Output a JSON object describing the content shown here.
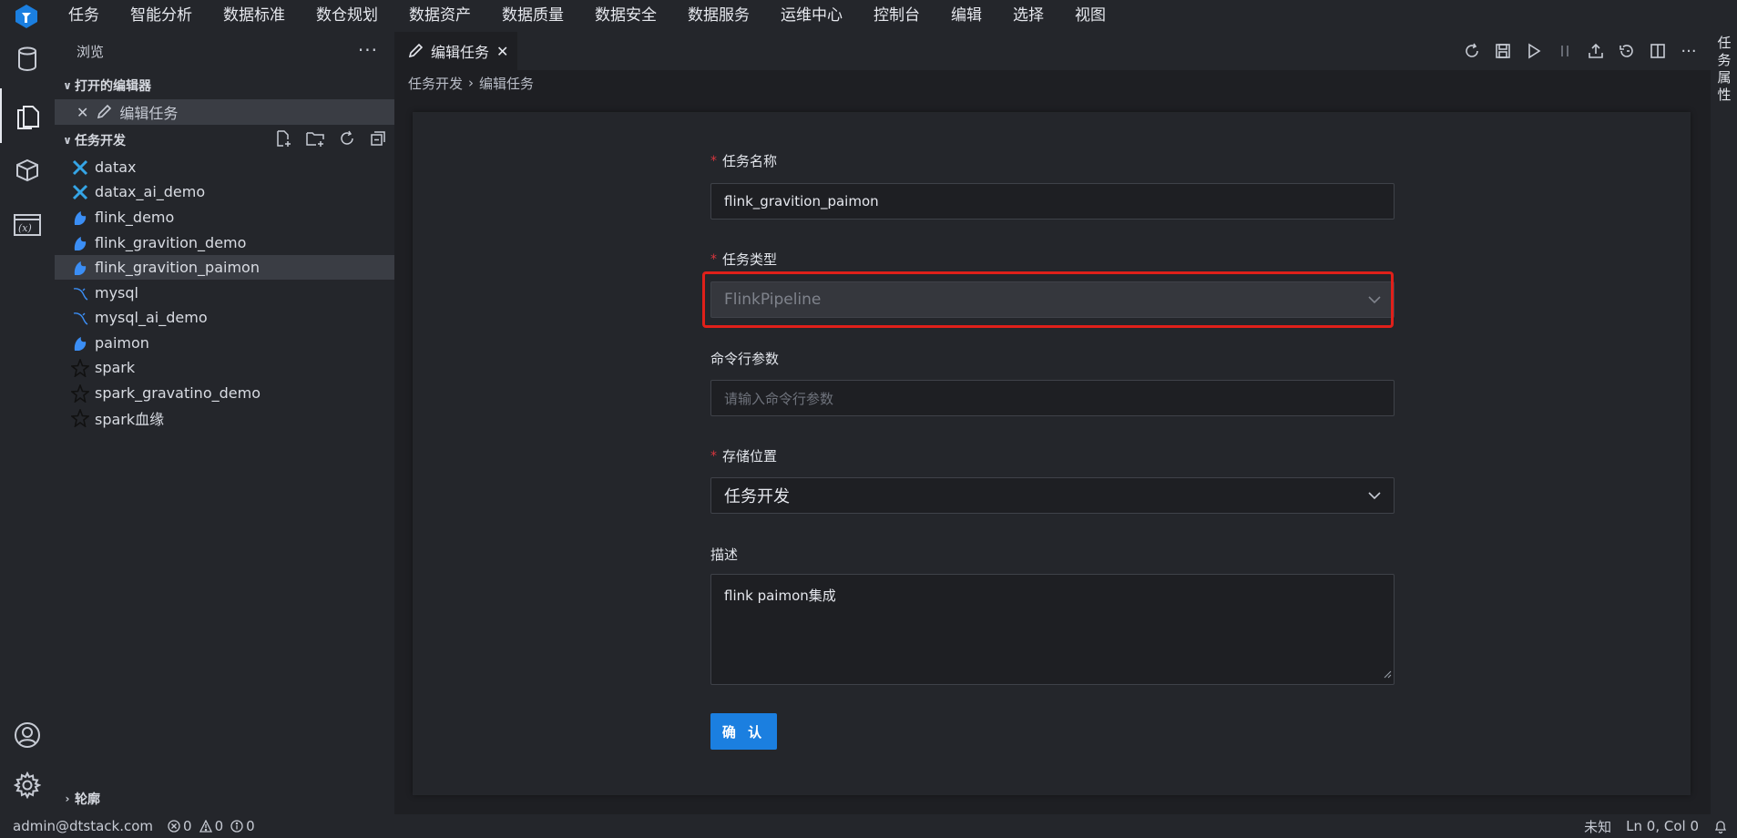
{
  "menubar": {
    "items": [
      "任务",
      "智能分析",
      "数据标准",
      "数仓规划",
      "数据资产",
      "数据质量",
      "数据安全",
      "数据服务",
      "运维中心",
      "控制台",
      "编辑",
      "选择",
      "视图"
    ]
  },
  "sidebar": {
    "title": "浏览",
    "open_editors_title": "打开的编辑器",
    "open_editor_item": "编辑任务",
    "task_dev_title": "任务开发",
    "items": [
      {
        "label": "datax",
        "icon": "datax-icon"
      },
      {
        "label": "datax_ai_demo",
        "icon": "datax-icon"
      },
      {
        "label": "flink_demo",
        "icon": "flink-icon"
      },
      {
        "label": "flink_gravition_demo",
        "icon": "flink-icon"
      },
      {
        "label": "flink_gravition_paimon",
        "icon": "flink-icon"
      },
      {
        "label": "mysql",
        "icon": "mysql-icon"
      },
      {
        "label": "mysql_ai_demo",
        "icon": "mysql-icon"
      },
      {
        "label": "paimon",
        "icon": "flink-icon"
      },
      {
        "label": "spark",
        "icon": "spark-icon"
      },
      {
        "label": "spark_gravatino_demo",
        "icon": "spark-icon"
      },
      {
        "label": "spark血缘",
        "icon": "spark-icon"
      }
    ],
    "selected_index": 4,
    "outline_title": "轮廓"
  },
  "editor": {
    "tab_label": "编辑任务",
    "breadcrumb": [
      "任务开发",
      "编辑任务"
    ],
    "right_panel_label": "任务属性"
  },
  "form": {
    "name_label": "任务名称",
    "name_value": "flink_gravition_paimon",
    "type_label": "任务类型",
    "type_value": "FlinkPipeline",
    "args_label": "命令行参数",
    "args_placeholder": "请输入命令行参数",
    "storage_label": "存储位置",
    "storage_value": "任务开发",
    "desc_label": "描述",
    "desc_value": "flink paimon集成",
    "confirm_label": "确 认",
    "required_mark": "*"
  },
  "statusbar": {
    "user": "admin@dtstack.com",
    "errors": "0",
    "warnings": "0",
    "infos": "0",
    "language": "未知",
    "position": "Ln 0, Col 0"
  },
  "colors": {
    "accent": "#1b7fe0",
    "highlight": "#e0201a",
    "required": "#d9363e"
  }
}
